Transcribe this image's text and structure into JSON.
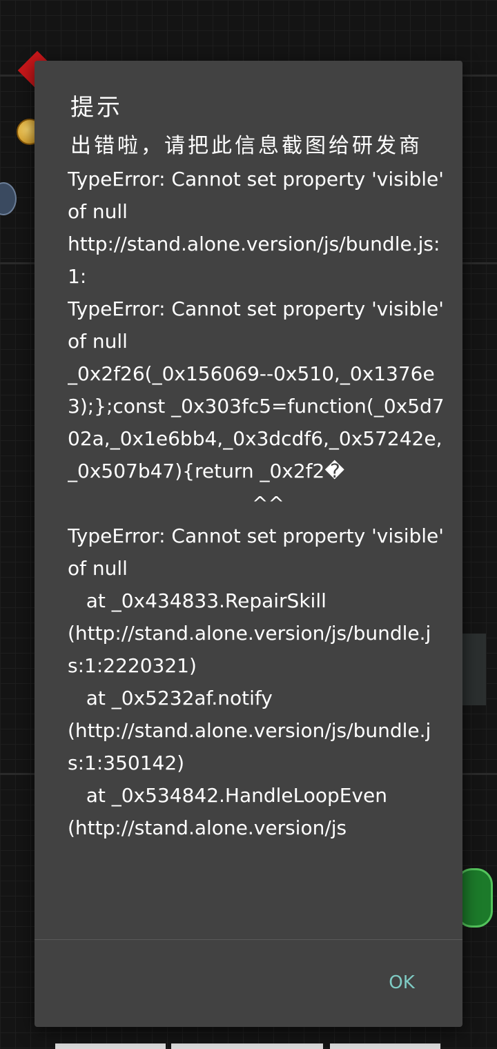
{
  "dialog": {
    "title": "提示",
    "message": "出错啦，请把此信息截图给研发商",
    "error_text": "TypeError: Cannot set property 'visible' of null\nhttp://stand.alone.version/js/bundle.js:1:\nTypeError: Cannot set property 'visible' of null\n_0x2f26(_0x156069--0x510,_0x1376e3);};const _0x303fc5=function(_0x5d702a,_0x1e6bb4,_0x3dcdf6,_0x57242e,_0x507b47){return _0x2f2�\n                              ^^\nTypeError: Cannot set property 'visible' of null\n   at _0x434833.RepairSkill\n(http://stand.alone.version/js/bundle.js:1:2220321)\n   at _0x5232af.notify\n(http://stand.alone.version/js/bundle.js:1:350142)\n   at _0x534842.HandleLoopEven\n(http://stand.alone.version/js",
    "ok_label": "OK"
  },
  "colors": {
    "dialog_bg": "#424242",
    "text": "#ffffff",
    "accent": "#7fcbc4"
  }
}
